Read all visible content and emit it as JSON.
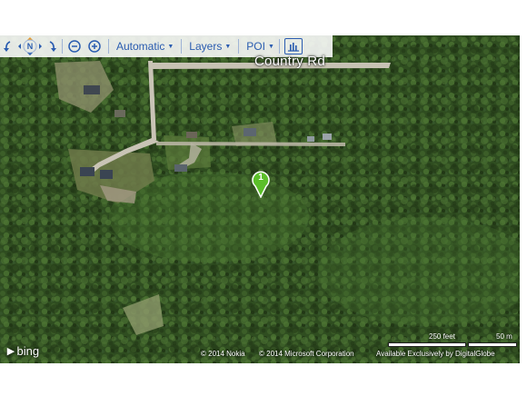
{
  "toolbar": {
    "rotate_left_icon": "rotate-left-icon",
    "compass_label": "N",
    "rotate_right_icon": "rotate-right-icon",
    "zoom_out_icon": "zoom-out-icon",
    "zoom_in_icon": "zoom-in-icon",
    "map_style_label": "Automatic",
    "layers_label": "Layers",
    "poi_label": "POI",
    "chart_icon": "bar-chart-icon"
  },
  "map": {
    "road_label": "Country Rd",
    "pin_number": "1"
  },
  "footer": {
    "logo_text": "bing",
    "copyright_nokia": "© 2014 Nokia",
    "copyright_microsoft": "© 2014 Microsoft Corporation",
    "imagery_credit": "Available Exclusively by DigitalGlobe",
    "scale_feet": "250 feet",
    "scale_meters": "50 m"
  },
  "colors": {
    "accent": "#2a5cb0",
    "pin": "#5bbf2a",
    "forest": "#2d4a1e"
  }
}
